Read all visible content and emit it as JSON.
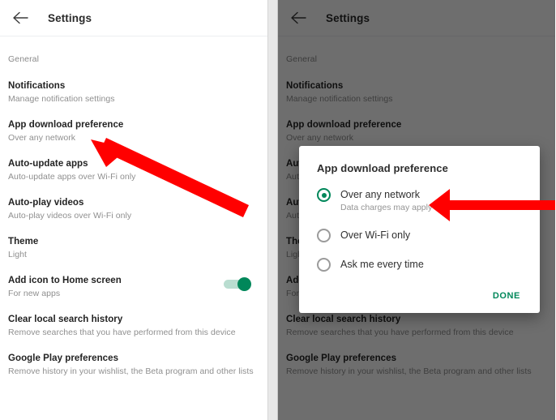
{
  "appbar": {
    "title": "Settings",
    "back_icon": "arrow-left-icon"
  },
  "settings_list": {
    "section_label": "General",
    "items": [
      {
        "title": "Notifications",
        "subtitle": "Manage notification settings"
      },
      {
        "title": "App download preference",
        "subtitle": "Over any network"
      },
      {
        "title": "Auto-update apps",
        "subtitle": "Auto-update apps over Wi-Fi only"
      },
      {
        "title": "Auto-play videos",
        "subtitle": "Auto-play videos over Wi-Fi only"
      },
      {
        "title": "Theme",
        "subtitle": "Light"
      },
      {
        "title": "Add icon to Home screen",
        "subtitle": "For new apps",
        "toggle": "on"
      },
      {
        "title": "Clear local search history",
        "subtitle": "Remove searches that you have performed from this device"
      },
      {
        "title": "Google Play preferences",
        "subtitle": "Remove history in your wishlist, the Beta program and other lists"
      }
    ]
  },
  "dialog": {
    "title": "App download preference",
    "options": [
      {
        "label": "Over any network",
        "subtitle": "Data charges may apply",
        "selected": true
      },
      {
        "label": "Over Wi-Fi only",
        "subtitle": "",
        "selected": false
      },
      {
        "label": "Ask me every time",
        "subtitle": "",
        "selected": false
      }
    ],
    "done_label": "DONE"
  },
  "annotations": {
    "left_arrow_name": "red-arrow-pointing-to-app-download-preference",
    "right_arrow_name": "red-arrow-pointing-to-over-any-network"
  },
  "colors": {
    "accent_green": "#00875a",
    "title_text": "#232323",
    "subtitle_text": "#8f8f8f",
    "annotation_red": "#ff0000"
  }
}
